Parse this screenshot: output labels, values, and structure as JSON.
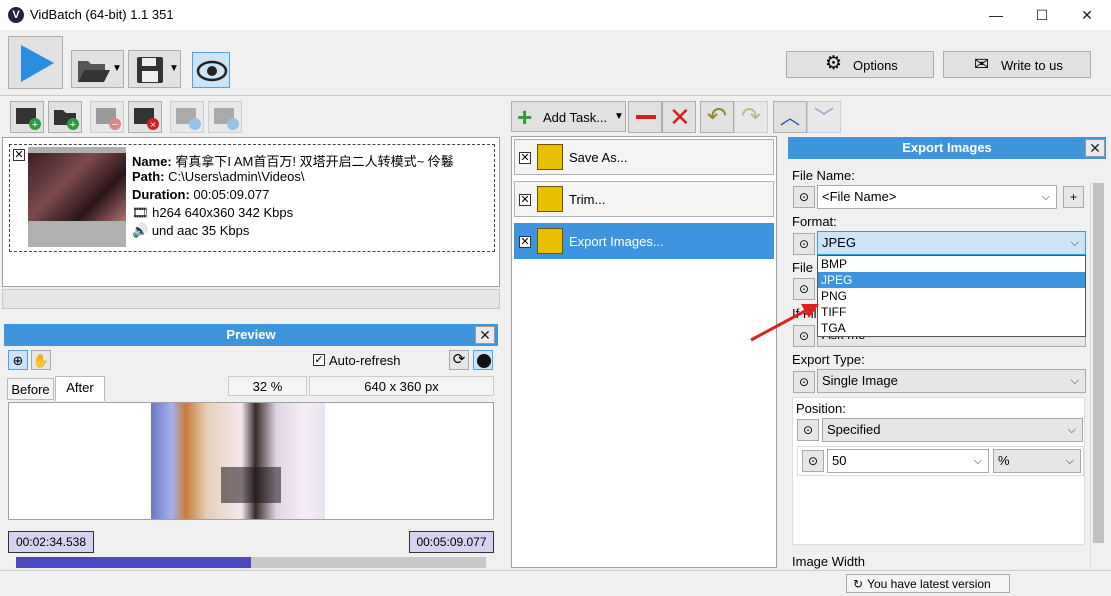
{
  "window": {
    "logo_letter": "V",
    "title": "VidBatch (64-bit) 1.1 351",
    "minimize": "—",
    "maximize": "☐",
    "close": "✕"
  },
  "toolbar": {
    "options_label": "Options",
    "write_label": "Write to us"
  },
  "file": {
    "name_label": "Name:",
    "name_value": "宥真拿下I AM首百万! 双塔开启二人转模式~ 伶鬈",
    "path_label": "Path:",
    "path_value": "C:\\Users\\admin\\Videos\\",
    "duration_label": "Duration:",
    "duration_value": "00:05:09.077",
    "video_info": "h264 640x360 342 Kbps",
    "audio_info": "und aac 35 Kbps"
  },
  "preview": {
    "title": "Preview",
    "auto_refresh": "Auto-refresh",
    "tab_before": "Before",
    "tab_after": "After",
    "zoom": "32 %",
    "size": "640 x 360 px",
    "time_start": "00:02:34.538",
    "time_end": "00:05:09.077",
    "progress": 0.5
  },
  "tasks": {
    "add_label": "Add Task...",
    "items": [
      {
        "label": "Save As..."
      },
      {
        "label": "Trim..."
      },
      {
        "label": "Export Images..."
      }
    ]
  },
  "export": {
    "title": "Export Images",
    "file_name_label": "File Name:",
    "file_name_value": "<File Name>",
    "format_label": "Format:",
    "format_value": "JPEG",
    "format_options": [
      "BMP",
      "JPEG",
      "PNG",
      "TIFF",
      "TGA"
    ],
    "file_label_partial": "File",
    "if_label_partial": "If Fil",
    "ask_partial": "Ask me",
    "export_type_label": "Export Type:",
    "export_type_value": "Single Image",
    "position_label": "Position:",
    "position_value": "Specified",
    "position_number": "50",
    "position_unit": "%",
    "image_width_label": "Image Width"
  },
  "status": {
    "version": "You have latest version"
  },
  "colors": {
    "accent": "#3f95dd",
    "play": "#2a8de0",
    "timeline_fill": "#4c47c2",
    "time_badge": "#d6d3f2",
    "arrow": "#e02020"
  }
}
